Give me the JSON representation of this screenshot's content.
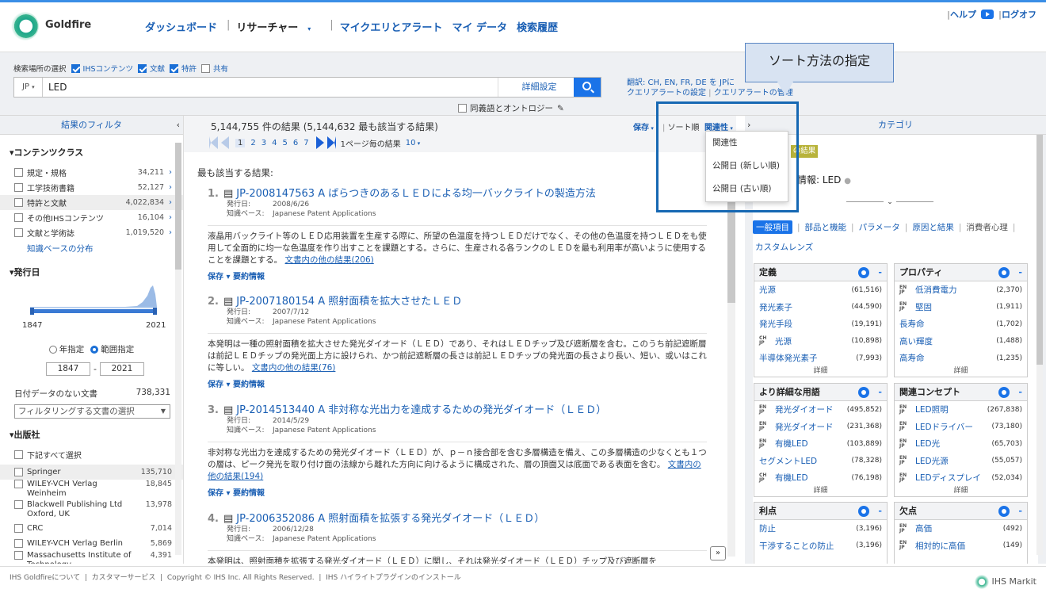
{
  "header": {
    "logo": "Goldfire",
    "nav": [
      "ダッシュボード",
      "リサーチャー",
      "マイクエリとアラート",
      "マイ データ",
      "検索履歴"
    ],
    "help": "ヘルプ",
    "logout": "ログオフ"
  },
  "search": {
    "scope_label": "検索場所の選択",
    "scopes": [
      {
        "label": "IHSコンテンツ",
        "checked": true
      },
      {
        "label": "文献",
        "checked": true
      },
      {
        "label": "特許",
        "checked": true
      },
      {
        "label": "共有",
        "checked": false
      }
    ],
    "lang": "JP",
    "query": "LED",
    "advanced": "詳細設定",
    "synonyms": "同義語とオントロジー",
    "translate": "翻訳: CH, EN, FR, DE を JPに",
    "alert_setting": "クエリアラートの設定",
    "alert_manage": "クエリアラートの管理"
  },
  "filters": {
    "title": "結果のフィルタ",
    "content_class": "コンテンツクラス",
    "classes": [
      {
        "label": "規定・規格",
        "n": "34,211"
      },
      {
        "label": "工学技術書籍",
        "n": "52,127"
      },
      {
        "label": "特許と文献",
        "n": "4,022,834"
      },
      {
        "label": "その他IHSコンテンツ",
        "n": "16,104"
      },
      {
        "label": "文献と学術誌",
        "n": "1,019,520"
      }
    ],
    "kb_dist": "知識ベースの分布",
    "pubdate": "発行日",
    "y_from": "1847",
    "y_to": "2021",
    "mode_year": "年指定",
    "mode_range": "範囲指定",
    "no_date": "日付データのない文書",
    "no_date_n": "738,331",
    "filter_select": "フィルタリングする文書の選択",
    "publisher": "出版社",
    "select_all": "下記すべて選択",
    "publishers": [
      {
        "label": "Springer",
        "n": "135,710"
      },
      {
        "label": "WILEY-VCH Verlag Weinheim",
        "n": "18,845"
      },
      {
        "label": "Blackwell Publishing Ltd Oxford, UK",
        "n": "13,978"
      },
      {
        "label": "CRC",
        "n": "7,014"
      },
      {
        "label": "WILEY-VCH Verlag Berlin",
        "n": "5,869"
      },
      {
        "label": "Massachusetts Institute of Technology",
        "n": "4,391"
      }
    ]
  },
  "results": {
    "count": "5,144,755 件の結果 (5,144,632 最も該当する結果)",
    "pages": [
      "1",
      "2",
      "3",
      "4",
      "5",
      "6",
      "7"
    ],
    "per_page": "1ページ毎の結果",
    "per_page_n": "10",
    "save": "保存",
    "sort_label": "ソート順",
    "sort_value": "関連性",
    "best": "最も該当する結果:",
    "items": [
      {
        "num": "1.",
        "title": "JP-2008147563 A ばらつきのあるＬＥＤによる均一バックライトの製造方法",
        "date": "2008/6/26",
        "kb": "Japanese Patent Applications",
        "snippet": "液晶用バックライト等のＬＥＤ応用装置を生産する際に、所望の色温度を持つＬＥＤだけでなく、その他の色温度を持つＬＥＤをも使用して全面的に均一な色温度を作り出すことを課題とする。さらに、生産される各ランクのＬＥＤを最も利用率が高いように使用することを課題とする。",
        "more": "文書内の他の結果(206)"
      },
      {
        "num": "2.",
        "title": "JP-2007180154 A 照射面積を拡大させたＬＥＤ",
        "date": "2007/7/12",
        "kb": "Japanese Patent Applications",
        "snippet": "本発明は一種の照射面積を拡大させた発光ダイオード（ＬＥＤ）であり、それはＬＥＤチップ及び遮断層を含む。このうち前記遮断層は前記ＬＥＤチップの発光面上方に設けられ、かつ前記遮断層の長さは前記ＬＥＤチップの発光面の長さより長い、短い、或いはこれに等しい。",
        "more": "文書内の他の結果(76)"
      },
      {
        "num": "3.",
        "title": "JP-2014513440 A 非対称な光出力を達成するための発光ダイオード（ＬＥＤ）",
        "date": "2014/5/29",
        "kb": "Japanese Patent Applications",
        "snippet": "非対称な光出力を達成するための発光ダイオード（ＬＥＤ）が、ｐ－ｎ接合部を含む多層構造を備え、この多層構造の少なくとも１つの層は、ピーク発光を取り付け面の法線から離れた方向に向けるように構成された、層の頂面又は底面である表面を含む。",
        "more": "文書内の他の結果(194)"
      },
      {
        "num": "4.",
        "title": "JP-2006352086 A 照射面積を拡張する発光ダイオード（ＬＥＤ）",
        "date": "2006/12/28",
        "kb": "Japanese Patent Applications",
        "snippet": "本発明は、照射面積を拡張する発光ダイオード（ＬＥＤ）に関し、それは発光ダイオード（ＬＥＤ）チップ及び遮断層を",
        "more": ""
      }
    ],
    "date_label": "発行日:",
    "kb_label": "知識ベース:",
    "actions": [
      "保存",
      "要約情報"
    ]
  },
  "sort_menu": [
    "関連性",
    "公開日 (新しい順)",
    "公開日 (古い順)"
  ],
  "callout": "ソート方法の指定",
  "category": {
    "title": "カテゴリ",
    "badge": "の結果",
    "qinfo": "情報: LED",
    "tabs": [
      "一般項目",
      "部品と機能",
      "パラメータ",
      "原因と結果",
      "消費者心理"
    ],
    "lens": "カスタムレンズ",
    "more": "詳細",
    "boxes": [
      {
        "title": "定義",
        "rows": [
          {
            "t": "光源",
            "c": "(61,516)",
            "l": ""
          },
          {
            "t": "発光素子",
            "c": "(44,590)",
            "l": ""
          },
          {
            "t": "発光手段",
            "c": "(19,191)",
            "l": ""
          },
          {
            "t": "光源",
            "c": "(10,898)",
            "l": "CH JP"
          },
          {
            "t": "半導体発光素子",
            "c": "(7,993)",
            "l": ""
          }
        ]
      },
      {
        "title": "プロパティ",
        "rows": [
          {
            "t": "低消費電力",
            "c": "(2,370)",
            "l": "EN JP"
          },
          {
            "t": "堅固",
            "c": "(1,911)",
            "l": "EN JP"
          },
          {
            "t": "長寿命",
            "c": "(1,702)",
            "l": ""
          },
          {
            "t": "高い輝度",
            "c": "(1,488)",
            "l": ""
          },
          {
            "t": "高寿命",
            "c": "(1,235)",
            "l": ""
          }
        ]
      },
      {
        "title": "より詳細な用語",
        "rows": [
          {
            "t": "発光ダイオード",
            "c": "(495,852)",
            "l": "EN JP"
          },
          {
            "t": "発光ダイオード",
            "c": "(231,368)",
            "l": "EN JP"
          },
          {
            "t": "有機LED",
            "c": "(103,889)",
            "l": "EN JP"
          },
          {
            "t": "セグメントLED",
            "c": "(78,328)",
            "l": ""
          },
          {
            "t": "有機LED",
            "c": "(76,198)",
            "l": "CH JP"
          }
        ]
      },
      {
        "title": "関連コンセプト",
        "rows": [
          {
            "t": "LED照明",
            "c": "(267,838)",
            "l": "EN JP"
          },
          {
            "t": "LEDドライバー",
            "c": "(73,180)",
            "l": "EN JP"
          },
          {
            "t": "LED光",
            "c": "(65,703)",
            "l": "EN JP"
          },
          {
            "t": "LED光源",
            "c": "(55,057)",
            "l": "EN JP"
          },
          {
            "t": "LEDディスプレイ",
            "c": "(52,034)",
            "l": "EN JP"
          }
        ]
      },
      {
        "title": "利点",
        "rows": [
          {
            "t": "防止",
            "c": "(3,196)",
            "l": ""
          },
          {
            "t": "干渉することの防止",
            "c": "(3,196)",
            "l": ""
          }
        ]
      },
      {
        "title": "欠点",
        "rows": [
          {
            "t": "高価",
            "c": "(492)",
            "l": "EN JP"
          },
          {
            "t": "相対的に高価",
            "c": "(149)",
            "l": "EN JP"
          }
        ]
      }
    ]
  },
  "footer": {
    "text": "IHS Goldfireについて  |  カスタマーサービス  |  Copyright © IHS Inc. All Rights Reserved.  |  IHS ハイライトプラグインのインストール",
    "brand": "IHS Markit"
  }
}
